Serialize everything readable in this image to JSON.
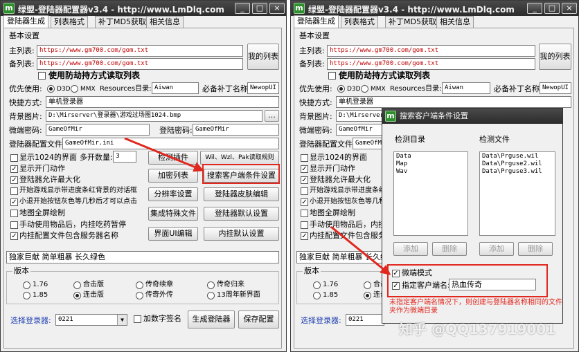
{
  "window": {
    "title": "绿盟-登陆器配置器v3.4 - http://www.LmDlq.com",
    "logo": "m",
    "min": "_",
    "max": "□",
    "close": "×"
  },
  "tabs": [
    "登陆器生成",
    "列表格式",
    "补丁MD5获取",
    "相关信息"
  ],
  "basic_settings": "基本设置",
  "main_list": {
    "label": "主列表:",
    "value": "https://www.gm700.com/gom.txt"
  },
  "backup_list": {
    "label": "备列表:",
    "value": "https://www.gm700.com/gom.txt"
  },
  "my_list_button": "我的列表",
  "anti_hijack": "使用防劫持方式读取列表",
  "priority": {
    "label": "优先使用:",
    "d3d": "D3D",
    "mmx": "MMX"
  },
  "resources": {
    "label": "Resources目录:",
    "value": "Aiwan"
  },
  "patch_name": {
    "label": "必备补丁名称:",
    "value": "NewopUI"
  },
  "shortcut": {
    "label": "快捷方式:",
    "value": "单机登录器"
  },
  "bg_image": {
    "label": "背景图片:",
    "value": "D:\\Mirserver\\登录器\\游戏过场图1024.bmp",
    "value_short": "D:\\Mirserver",
    "browse": "..."
  },
  "micro_pwd": {
    "label": "微端密码:",
    "value": "GameOfMir"
  },
  "login_pwd": {
    "label": "登陆密码:",
    "value": "GameOfMir"
  },
  "config_file": {
    "label": "登陆器配置文件:",
    "value": "GameOfMir.ini"
  },
  "checks": [
    {
      "label": "显示1024的界面",
      "checked": false
    },
    {
      "label": "显示开门动作",
      "checked": true
    },
    {
      "label": "登陆器允许最大化",
      "checked": true
    },
    {
      "label": "开始游戏显示带进度条红背景的对话框",
      "checked": false
    },
    {
      "label": "小退开始按钮灰色等几秒后才可以点击",
      "checked": true
    },
    {
      "label": "地图全屏绘制",
      "checked": false
    },
    {
      "label": "手动使用物品后，内挂吃药暂停",
      "checked": false
    },
    {
      "label": "内挂配置文件包含服务器名称",
      "checked": true
    }
  ],
  "multi_open": {
    "label": "多开数量:",
    "value": "3"
  },
  "buttons": {
    "plugin_detect": "检测插件",
    "wil_rule": "Wil、Wzl、Pak读取规则",
    "add_list": "加密列表",
    "client_search": "搜索客户端条件设置",
    "resolution": "分辨率设置",
    "skin_edit": "登陆器皮肤编辑",
    "special_file": "集成特殊文件",
    "default_settings": "登陆器默认设置",
    "ui_edit": "界面UI编辑",
    "plugin_default": "内挂默认设置"
  },
  "exclusive": "独家巨献  简单粗暴  长久绿色",
  "exclusive_short": "独家巨献  简单粗暴  长久绿",
  "version": {
    "label": "版本",
    "options": [
      "1.76",
      "合击版",
      "传奇续章",
      "传奇归来",
      "1.85",
      "连击版",
      "传奇外传",
      "13周年新界面"
    ],
    "opts_cut": [
      "合击",
      "连击"
    ]
  },
  "select_login": {
    "label": "选择登录器:",
    "value": "0221",
    "arrow": "▼"
  },
  "sign_check": "加数字签名",
  "generate": "生成登陆器",
  "save": "保存配置",
  "dialog": {
    "title": "搜索客户端条件设置",
    "dir_label": "检测目录",
    "file_label": "检测文件",
    "dirs": [
      "Data",
      "Map",
      "Wav"
    ],
    "files": [
      "Data\\Prguse.wil",
      "Data\\Prguse2.wil",
      "Data\\Prguse3.wil"
    ],
    "add": "添加",
    "del": "删除",
    "micro_mode": "微端模式",
    "client_name_label": "指定客户端名:",
    "client_name": "热血传奇"
  },
  "annotation": "未指定客户端名情况下，则创建与登陆器名称相同的文件夹作为微端目录",
  "watermark": "知乎 @QQ137919001",
  "colors": {
    "accent_red": "#e0281f",
    "select_blue": "#1f3fb0"
  }
}
